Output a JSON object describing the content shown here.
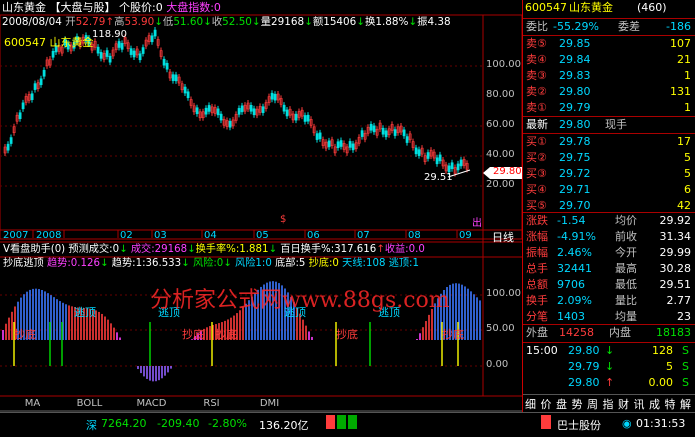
{
  "header": {
    "line1": {
      "name": "山东黄金",
      "links": "【大盘与股】",
      "stock_index": "个股价:0",
      "market_index": "大盘指数:0"
    },
    "line2": {
      "date": "2008/08/04",
      "open_label": "开",
      "open": "52.79",
      "high_label": "高",
      "high": "53.90",
      "low_label": "低",
      "low": "51.60",
      "close_label": "收",
      "close": "52.50",
      "volume": "量29168",
      "amount": "额15406",
      "turnover": "换1.88%",
      "amplitude": "振4.38"
    },
    "line3": {
      "code": "600547",
      "name": "山东黄金"
    }
  },
  "price_chart": {
    "high_label": "118.90",
    "low_label": "29.51",
    "current_price": "29.80",
    "y_axis": [
      "100.00",
      "80.00",
      "60.00",
      "40.00",
      "20.00"
    ],
    "x_axis": [
      "2007",
      "2008",
      "02",
      "03",
      "04",
      "05",
      "06",
      "07",
      "08",
      "09"
    ],
    "period_label": "日线",
    "weight_marks": [
      "$",
      "出"
    ]
  },
  "vol_bar": {
    "title": "V看盘助手(0) 预测成交:0",
    "volume": "成交:29168",
    "turnover": "换手率%:1.881",
    "hundred_day": "百日换手%:317.616",
    "profit": "收益:0.0"
  },
  "indicator": {
    "title": "抄底逃顶",
    "trend_a": "趋势:0.126",
    "trend_b": "趋势:1:36.533",
    "risk_a": "风险:0",
    "risk_b": "风险1:0",
    "bottom": "底部:5",
    "dip": "抄底:0",
    "sky": "天线:108",
    "top": "逃顶:1",
    "y_axis": [
      "100.00",
      "50.00",
      "0.00"
    ],
    "labels_dip": [
      "抄底",
      "抄底",
      "抄底",
      "抄底",
      "抄底"
    ],
    "labels_top": [
      "逃顶",
      "逃顶",
      "逃顶",
      "逃顶"
    ],
    "watermark": "分析家公式网www.88gs.com"
  },
  "tabs": [
    "MA",
    "BOLL",
    "MACD",
    "RSI",
    "DMI"
  ],
  "right_panel": {
    "code": "600547",
    "name": "山东黄金",
    "count": "(460)",
    "weibi_label": "委比",
    "weibi": "-55.29%",
    "weicha_label": "委差",
    "weicha": "-186",
    "asks": [
      {
        "label": "卖⑤",
        "price": "29.85",
        "vol": "107"
      },
      {
        "label": "卖④",
        "price": "29.84",
        "vol": "21"
      },
      {
        "label": "卖③",
        "price": "29.83",
        "vol": "1"
      },
      {
        "label": "卖②",
        "price": "29.80",
        "vol": "131"
      },
      {
        "label": "卖①",
        "price": "29.79",
        "vol": "1"
      }
    ],
    "latest_label": "最新",
    "latest": "29.80",
    "current_hand_label": "现手",
    "bids": [
      {
        "label": "买①",
        "price": "29.78",
        "vol": "17"
      },
      {
        "label": "买②",
        "price": "29.75",
        "vol": "5"
      },
      {
        "label": "买③",
        "price": "29.72",
        "vol": "5"
      },
      {
        "label": "买④",
        "price": "29.71",
        "vol": "6"
      },
      {
        "label": "买⑤",
        "price": "29.70",
        "vol": "42"
      }
    ],
    "stats": [
      {
        "l1": "涨跌",
        "v1": "-1.54",
        "l2": "均价",
        "v2": "29.92"
      },
      {
        "l1": "涨幅",
        "v1": "-4.91%",
        "l2": "前收",
        "v2": "31.34"
      },
      {
        "l1": "振幅",
        "v1": "2.46%",
        "l2": "今开",
        "v2": "29.99"
      },
      {
        "l1": "总手",
        "v1": "32441",
        "l2": "最高",
        "v2": "30.28"
      },
      {
        "l1": "总额",
        "v1": "9706",
        "l2": "最低",
        "v2": "29.51"
      },
      {
        "l1": "换手",
        "v1": "2.09%",
        "l2": "量比",
        "v2": "2.77"
      },
      {
        "l1": "分笔",
        "v1": "1403",
        "l2": "均量",
        "v2": "23"
      }
    ],
    "outer_label": "外盘",
    "outer": "14258",
    "inner_label": "内盘",
    "inner": "18183",
    "ticks": [
      {
        "time": "15:00",
        "price": "29.80",
        "dir": "↓",
        "vol": "128",
        "flag": "S"
      },
      {
        "time": "",
        "price": "29.79",
        "dir": "↓",
        "vol": "5",
        "flag": "S"
      },
      {
        "time": "",
        "price": "29.80",
        "dir": "↑",
        "vol": "0.00",
        "flag": "S"
      }
    ],
    "bottom_tabs": [
      "细",
      "价",
      "盘",
      "势",
      "周",
      "指",
      "财",
      "讯",
      "成",
      "特",
      "解"
    ]
  },
  "status": {
    "index_name": "深",
    "index_value": "7264.20",
    "change": "-209.40",
    "pct": "-2.80%",
    "amount": "136.20亿",
    "broker": "巴士股份",
    "clock": "01:31:53"
  }
}
